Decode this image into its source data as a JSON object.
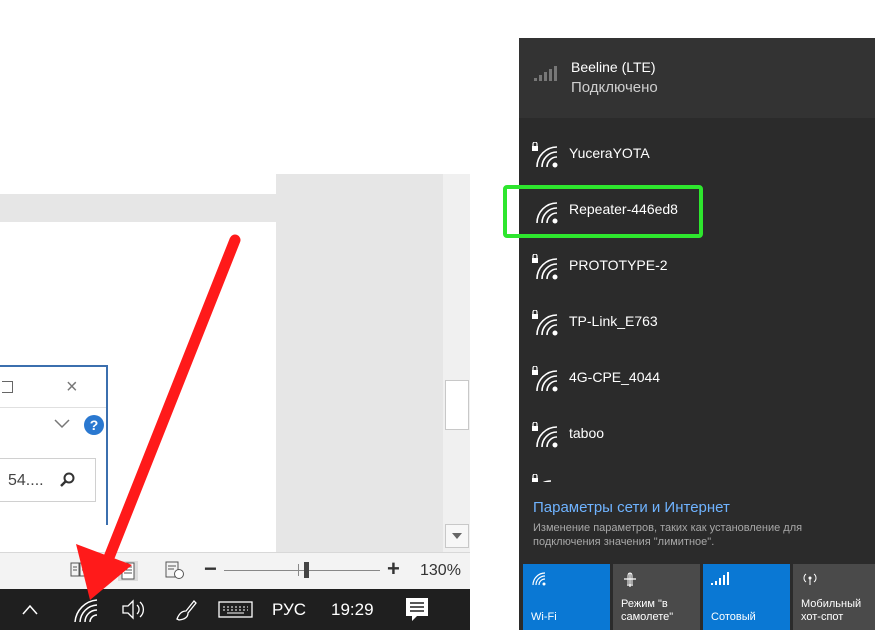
{
  "dialog": {
    "search_value": "54...."
  },
  "statusbar": {
    "zoom": "130%"
  },
  "taskbar": {
    "language": "РУС",
    "time": "19:29"
  },
  "flyout": {
    "cellular": {
      "name": "Beeline (LTE)",
      "status": "Подключено"
    },
    "networks": [
      {
        "name": "YuceraYOTA",
        "secured": true
      },
      {
        "name": "Repeater-446ed8",
        "secured": false
      },
      {
        "name": "PROTOTYPE-2",
        "secured": true
      },
      {
        "name": "TP-Link_E763",
        "secured": true
      },
      {
        "name": "4G-CPE_4044",
        "secured": true
      },
      {
        "name": "taboo",
        "secured": true
      }
    ],
    "settings_link": "Параметры сети и Интернет",
    "settings_desc": "Изменение параметров, таких как установление для подключения значения \"лимитное\".",
    "quick_actions": [
      {
        "label": "Wi-Fi",
        "active": true
      },
      {
        "label": "Режим \"в самолете\"",
        "active": false
      },
      {
        "label": "Сотовый",
        "active": true
      },
      {
        "label": "Мобильный хот-спот",
        "active": false
      }
    ]
  },
  "annotations": {
    "highlight_color": "#2ee62e",
    "arrow_color": "#ff1a1a"
  }
}
